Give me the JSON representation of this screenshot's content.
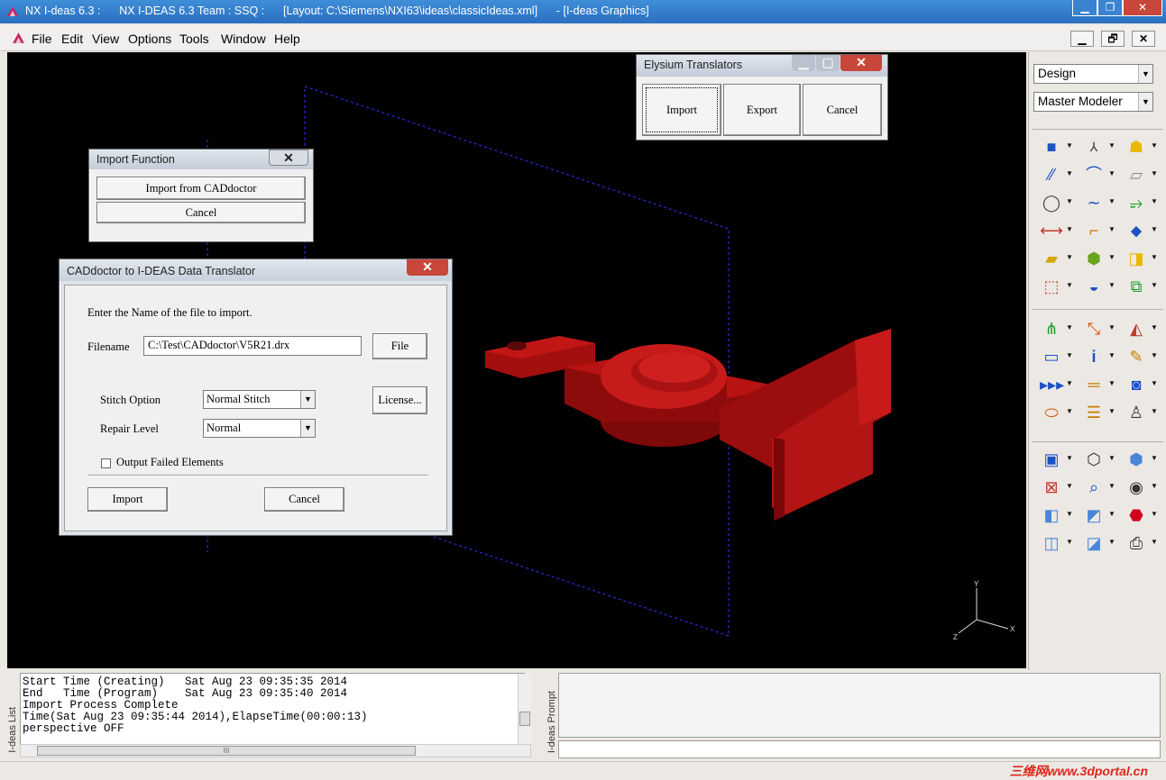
{
  "window": {
    "title": "NX I-deas 6.3 :      NX I-DEAS 6.3 Team : SSQ :      [Layout: C:\\Siemens\\NXI63\\ideas\\classicIdeas.xml]      - [I-deas Graphics]",
    "minimize": "▁",
    "restore": "❐",
    "close": "✕"
  },
  "menu": {
    "items": [
      "File",
      "Edit",
      "View",
      "Options",
      "Tools",
      "Window",
      "Help"
    ],
    "mdi_min": "▁",
    "mdi_restore": "🗗",
    "mdi_close": "✕"
  },
  "elysium": {
    "title": "Elysium Translators",
    "import": "Import",
    "export": "Export",
    "cancel": "Cancel"
  },
  "import_function": {
    "title": "Import Function",
    "import_from": "Import from CADdoctor",
    "cancel": "Cancel"
  },
  "translator": {
    "title": "CADdoctor to I-DEAS Data Translator",
    "instruction": "Enter the Name of the file to import.",
    "filename_label": "Filename",
    "filename_value": "C:\\Test\\CADdoctor\\V5R21.drx",
    "file_button": "File",
    "stitch_label": "Stitch Option",
    "stitch_value": "Normal Stitch",
    "license_button": "License...",
    "repair_label": "Repair Level",
    "repair_value": "Normal",
    "output_failed_label": "Output Failed Elements",
    "output_failed_checked": false,
    "import_button": "Import",
    "cancel_button": "Cancel"
  },
  "rightpanel": {
    "task_combo": "Design",
    "application_combo": "Master Modeler"
  },
  "triad": {
    "y": "Y",
    "x": "X",
    "z": "Z"
  },
  "list": {
    "label": "I-deas List",
    "lines": [
      "Start Time (Creating)   Sat Aug 23 09:35:35 2014",
      "End   Time (Program)    Sat Aug 23 09:35:40 2014",
      "Import Process Complete",
      "Time(Sat Aug 23 09:35:44 2014),ElapseTime(00:00:13)",
      "perspective OFF"
    ],
    "hscroll_grip": "III"
  },
  "prompt": {
    "label": "I-deas Prompt"
  },
  "watermark": "三维网www.3dportal.cn",
  "colors": {
    "title_blue": "#2a6fc0",
    "part_red": "#b01010",
    "close_red": "#c8463a",
    "viewport": "#000000"
  }
}
